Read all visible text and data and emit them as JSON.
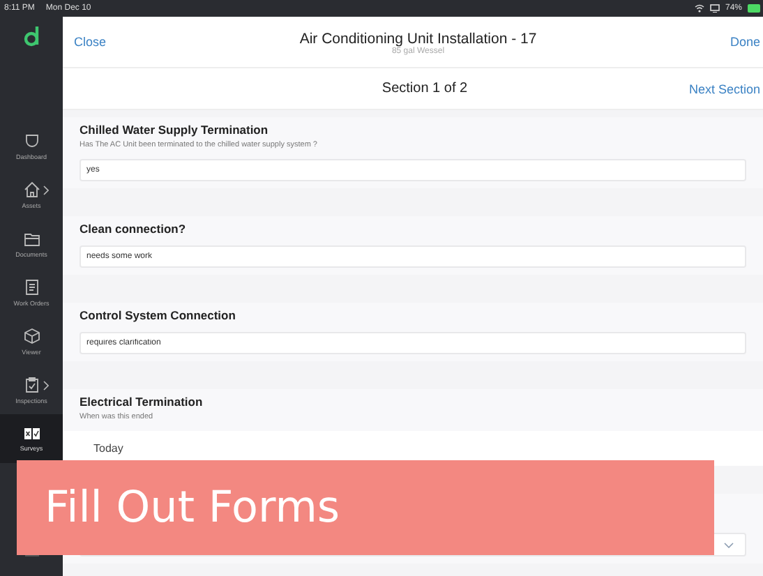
{
  "status_bar": {
    "time": "8:11 PM",
    "date": "Mon Dec 10",
    "battery": "74%"
  },
  "sidebar": {
    "items": [
      {
        "label": "Dashboard",
        "has_submenu": false,
        "selected": false
      },
      {
        "label": "Assets",
        "has_submenu": true,
        "selected": false
      },
      {
        "label": "Documents",
        "has_submenu": false,
        "selected": false
      },
      {
        "label": "Work Orders",
        "has_submenu": false,
        "selected": false
      },
      {
        "label": "Viewer",
        "has_submenu": false,
        "selected": false
      },
      {
        "label": "Inspections",
        "has_submenu": true,
        "selected": false
      },
      {
        "label": "Surveys",
        "has_submenu": false,
        "selected": true
      }
    ]
  },
  "header": {
    "close": "Close",
    "title": "Air Conditioning Unit Installation - 17",
    "subtitle": "85 gal Wessel",
    "done": "Done"
  },
  "section_bar": {
    "title": "Section 1 of 2",
    "next": "Next Section"
  },
  "questions": [
    {
      "kind": "text",
      "title": "Chilled Water Supply Termination",
      "description": "Has The AC Unit been terminated to the chilled water supply system ?",
      "value": "yes"
    },
    {
      "kind": "text",
      "title": "Clean connection?",
      "value": "needs some work"
    },
    {
      "kind": "text",
      "title": "Control System Connection",
      "value": "requires clarification"
    },
    {
      "kind": "date",
      "title": "Electrical Termination",
      "description": "When was this ended",
      "value": "Today"
    },
    {
      "kind": "select"
    }
  ],
  "caption_banner": {
    "text": "Fill Out Forms"
  }
}
